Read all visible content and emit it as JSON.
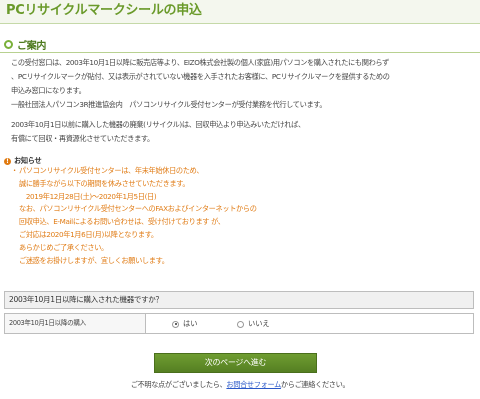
{
  "page_title": "PCリサイクルマークシールの申込",
  "section": {
    "title": "ご案内",
    "intro_lines": [
      "この受付窓口は、2003年10月1日以降に販売店等より、EIZO株式会社製の個人(家庭)用パソコンを購入されたにも関わらず",
      "、PCリサイクルマークが貼付、又は表示がされていない機器を入手されたお客様に、PCリサイクルマークを提供するための",
      "申込み窓口になります。",
      "一般社団法人パソコン3R推進協会内　パソコンリサイクル受付センターが受付業務を代行しています。"
    ],
    "second_lines": [
      "2003年10月1日以前に購入した機器の廃棄(リサイクル)は、回収申込より申込みいただければ、",
      "有償にて回収・再資源化させていただきます。"
    ]
  },
  "notice": {
    "label": "お知らせ",
    "bullet": "・",
    "lines": [
      "パソコンリサイクル受付センターは、年末年始休日のため、",
      "誠に勝手ながら以下の期間を休みさせていただきます。",
      "　2019年12月28日(土)～2020年1月5日(日)",
      "なお、パソコンリサイクル受付センターへのFAXおよびインターネットからの",
      "回収申込、E-Mailによるお問い合わせは、受け付けております が、",
      "ご対応は2020年1月6日(月)以降となります。",
      "あらかじめご了承ください。",
      "ご迷惑をお掛けしますが、宜しくお願いします。"
    ]
  },
  "question": {
    "header": "2003年10月1日以降に購入された機器ですか？",
    "row_label": "2003年10月1日以降の購入",
    "options": [
      {
        "label": "はい",
        "selected": true
      },
      {
        "label": "いいえ",
        "selected": false
      }
    ]
  },
  "next_button": "次のページへ進む",
  "footer": {
    "before": "ご不明な点がございましたら、",
    "link": "お問合せフォーム",
    "after": "からご連絡ください。"
  },
  "colors": {
    "accent_green": "#6a9a2a",
    "notice_orange": "#e07b14",
    "link_blue": "#2a58c8"
  }
}
